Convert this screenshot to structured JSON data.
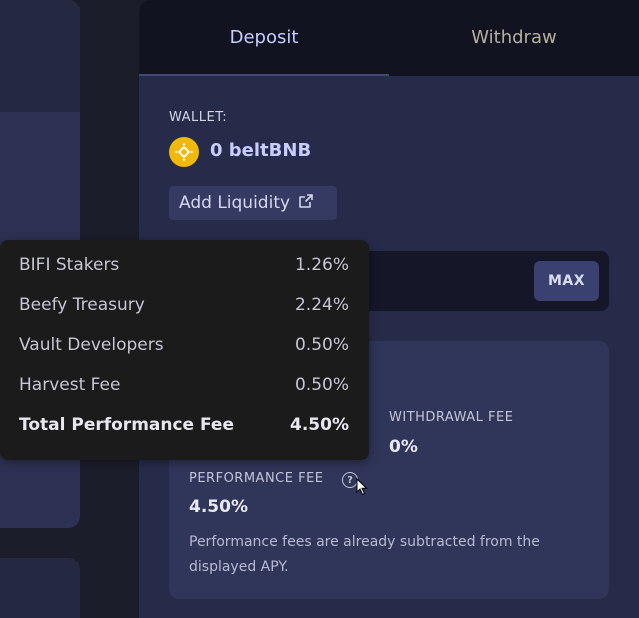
{
  "tabs": [
    {
      "label": "Deposit",
      "active": true
    },
    {
      "label": "Withdraw",
      "active": false
    }
  ],
  "wallet": {
    "label": "WALLET:",
    "balance": "0 beltBNB",
    "token_icon": "bnb-icon",
    "token_color": "#f0b90b"
  },
  "add_liquidity": {
    "label": "Add Liquidity",
    "icon": "external-link-icon"
  },
  "amount": {
    "max_label": "MAX"
  },
  "fees": {
    "withdrawal_label": "WITHDRAWAL FEE",
    "withdrawal_value": "0%",
    "performance_label": "PERFORMANCE FEE",
    "performance_value": "4.50%",
    "performance_note": "Performance fees are already subtracted from the displayed APY.",
    "help_icon": "question-circle-icon"
  },
  "tooltip": {
    "rows": [
      {
        "label": "BIFI Stakers",
        "value": "1.26%"
      },
      {
        "label": "Beefy Treasury",
        "value": "2.24%"
      },
      {
        "label": "Vault Developers",
        "value": "0.50%"
      },
      {
        "label": "Harvest Fee",
        "value": "0.50%"
      },
      {
        "label": "Total Performance Fee",
        "value": "4.50%"
      }
    ]
  },
  "colors": {
    "accent": "#c7cdff",
    "panel_bg": "#272b4a",
    "tooltip_bg": "#1b1b1c"
  }
}
